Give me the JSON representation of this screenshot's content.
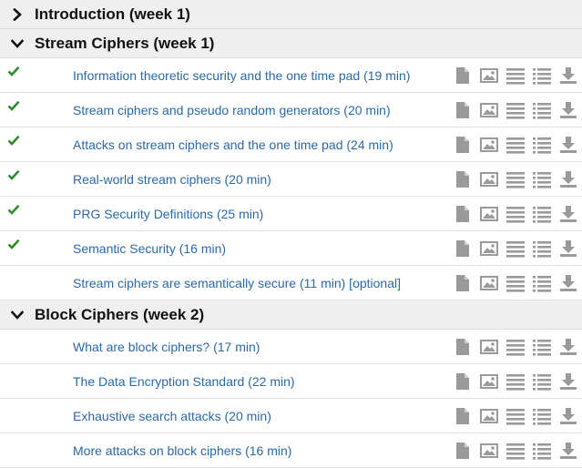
{
  "colors": {
    "accent": "#2a6aa8",
    "check": "#2e8b2e",
    "icon": "#9a9a9a",
    "header_bg": "#efefef"
  },
  "sections": [
    {
      "title": "Introduction (week 1)",
      "expanded": false,
      "chevron_icon": "chevron-right-icon",
      "lectures": []
    },
    {
      "title": "Stream Ciphers (week 1)",
      "expanded": true,
      "chevron_icon": "chevron-down-icon",
      "lectures": [
        {
          "title": "Information theoretic security and the one time pad (19 min)",
          "completed": true
        },
        {
          "title": "Stream ciphers and pseudo random generators (20 min)",
          "completed": true
        },
        {
          "title": "Attacks on stream ciphers and the one time pad (24 min)",
          "completed": true
        },
        {
          "title": "Real-world stream ciphers (20 min)",
          "completed": true
        },
        {
          "title": "PRG Security Definitions (25 min)",
          "completed": true
        },
        {
          "title": "Semantic Security (16 min)",
          "completed": true
        },
        {
          "title": "Stream ciphers are semantically secure (11 min) [optional]",
          "completed": false
        }
      ]
    },
    {
      "title": "Block Ciphers (week 2)",
      "expanded": true,
      "chevron_icon": "chevron-down-icon",
      "lectures": [
        {
          "title": "What are block ciphers? (17 min)",
          "completed": false
        },
        {
          "title": "The Data Encryption Standard (22 min)",
          "completed": false
        },
        {
          "title": "Exhaustive search attacks (20 min)",
          "completed": false
        },
        {
          "title": "More attacks on block ciphers (16 min)",
          "completed": false
        }
      ]
    }
  ],
  "lecture_icons": [
    "document-icon",
    "slides-image-icon",
    "transcript-icon",
    "subtitles-list-icon",
    "download-icon"
  ]
}
